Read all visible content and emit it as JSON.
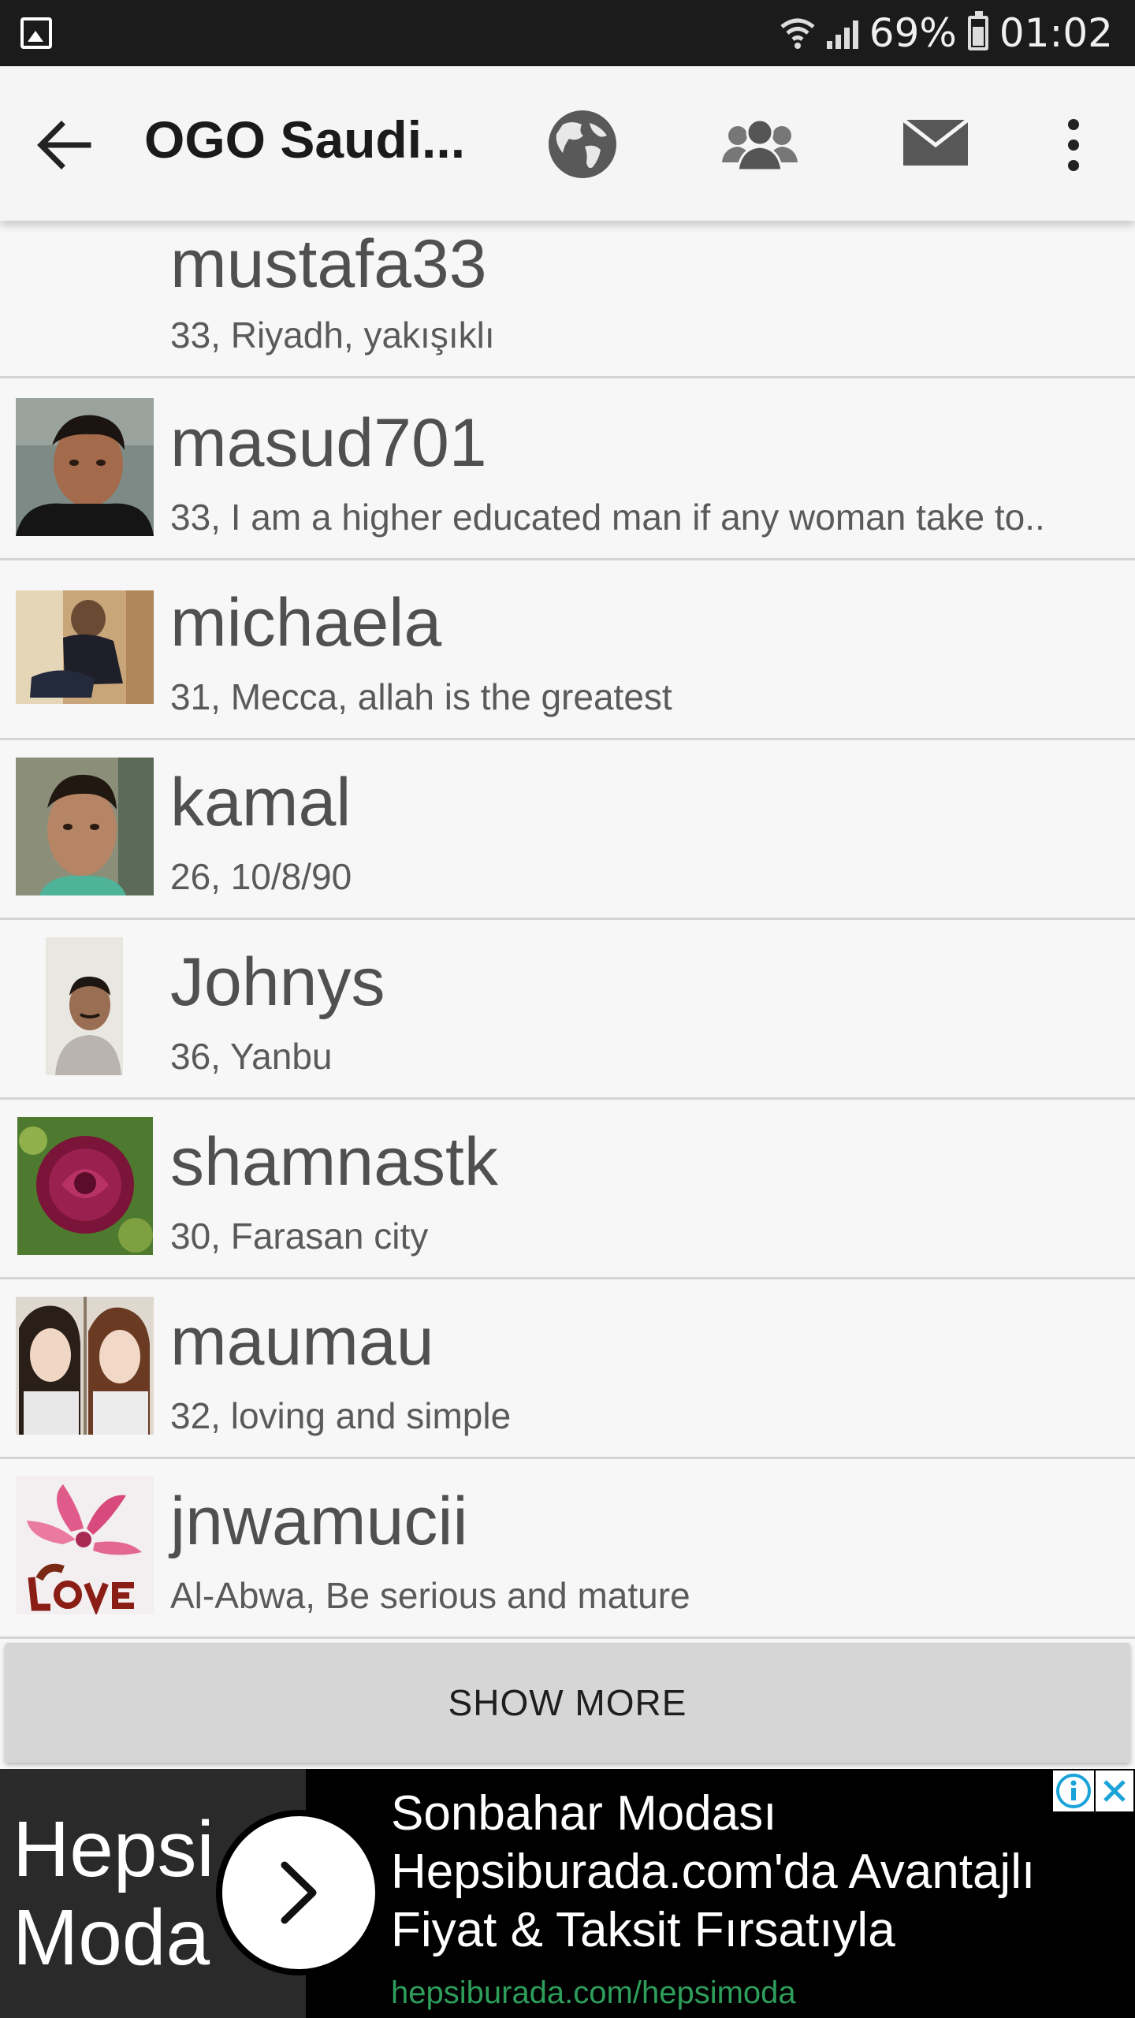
{
  "status_bar": {
    "battery": "69%",
    "time": "01:02"
  },
  "app_bar": {
    "title": "OGO Saudi..."
  },
  "users": [
    {
      "username": "mustafa33",
      "info": "33, Riyadh, yakışıklı",
      "has_photo": false
    },
    {
      "username": "masud701",
      "info": "33, I am a higher educated man if any woman take to..",
      "has_photo": true
    },
    {
      "username": "michaela",
      "info": "31, Mecca, allah is the greatest",
      "has_photo": true
    },
    {
      "username": "kamal",
      "info": "26, 10/8/90",
      "has_photo": true
    },
    {
      "username": "Johnys",
      "info": "36, Yanbu",
      "has_photo": true
    },
    {
      "username": "shamnastk",
      "info": "30, Farasan city",
      "has_photo": true
    },
    {
      "username": "maumau",
      "info": "32, loving and simple",
      "has_photo": true
    },
    {
      "username": "jnwamucii",
      "info": "Al-Abwa, Be serious and mature",
      "has_photo": true
    }
  ],
  "show_more_label": "SHOW MORE",
  "ad": {
    "brand_line1": "Hepsi",
    "brand_line2": "Moda",
    "headline_line1": "Sonbahar Modası",
    "headline_line2": "Hepsiburada.com'da Avantajlı",
    "headline_line3": "Fiyat & Taksit Fırsatıyla",
    "url": "hepsiburada.com/hepsimoda"
  },
  "colors": {
    "accent_ad_url": "#2e9e5b",
    "adchoices": "#1aa3d9"
  }
}
